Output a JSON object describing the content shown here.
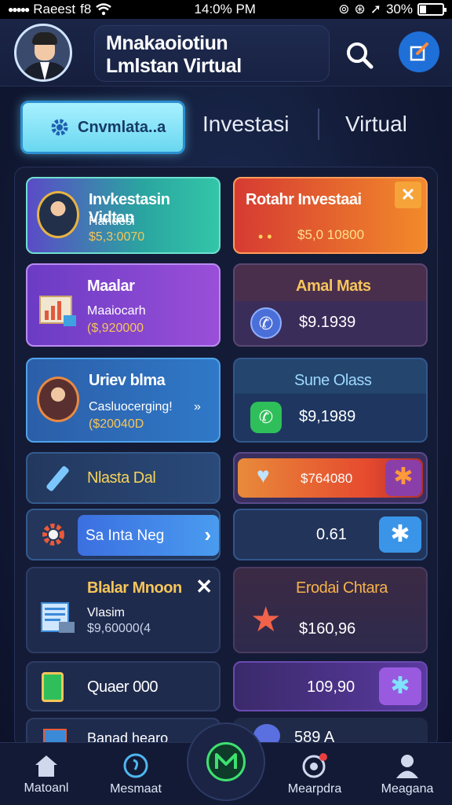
{
  "status": {
    "carrier": "Raeest",
    "network": "f8",
    "time": "14:0% PM",
    "battery": "30%",
    "battery_level": 0.3
  },
  "header": {
    "title_line1": "Mnakaoiotiun",
    "title_line2": "Lmlstan Virtual"
  },
  "tabs": {
    "active_label": "Cnvmlata..a",
    "tab2": "Investasi",
    "tab3": "Virtual"
  },
  "cards": {
    "c1": {
      "title": "Invkestasin Vidtan",
      "sub": "Handesi",
      "value": "$5,3:0070"
    },
    "c2": {
      "title": "Rotahr Investaai",
      "value": "$5,0 10800"
    },
    "c3": {
      "title": "Maalar",
      "sub": "Maaiocarh",
      "value": "($,920000"
    },
    "c4": {
      "title": "Amal Mats",
      "value": "$9.1939"
    },
    "c5": {
      "title": "Uriev blma",
      "sub": "Casluocerging!",
      "arrow": "»",
      "value": "($20040D"
    },
    "c6": {
      "title": "Sune Olass",
      "value": "$9,1989"
    },
    "c7": {
      "title": "Nlasta Dal"
    },
    "c8": {
      "value": "$764080"
    },
    "c9": {
      "label": "Sa Inta Neg"
    },
    "c10": {
      "value": "0.61"
    },
    "c11": {
      "title": "Blalar Mnoon",
      "sub": "Vlasim",
      "value": "$9,60000(4"
    },
    "c12": {
      "title": "Erodai Chtara",
      "value": "$160,96"
    },
    "c13": {
      "title": "Quaer 000"
    },
    "c14": {
      "value": "109,90"
    },
    "c15": {
      "title": "Banad hearo"
    },
    "c16": {
      "value": "589 A"
    }
  },
  "nav": {
    "item1": "Matoanl",
    "item2": "Mesmaat",
    "item4": "Mearpdra",
    "item5": "Meagana"
  },
  "colors": {
    "accent": "#69d7f0",
    "green": "#3ee070",
    "gold": "#f6c55a",
    "orange": "#ff7a2e"
  }
}
